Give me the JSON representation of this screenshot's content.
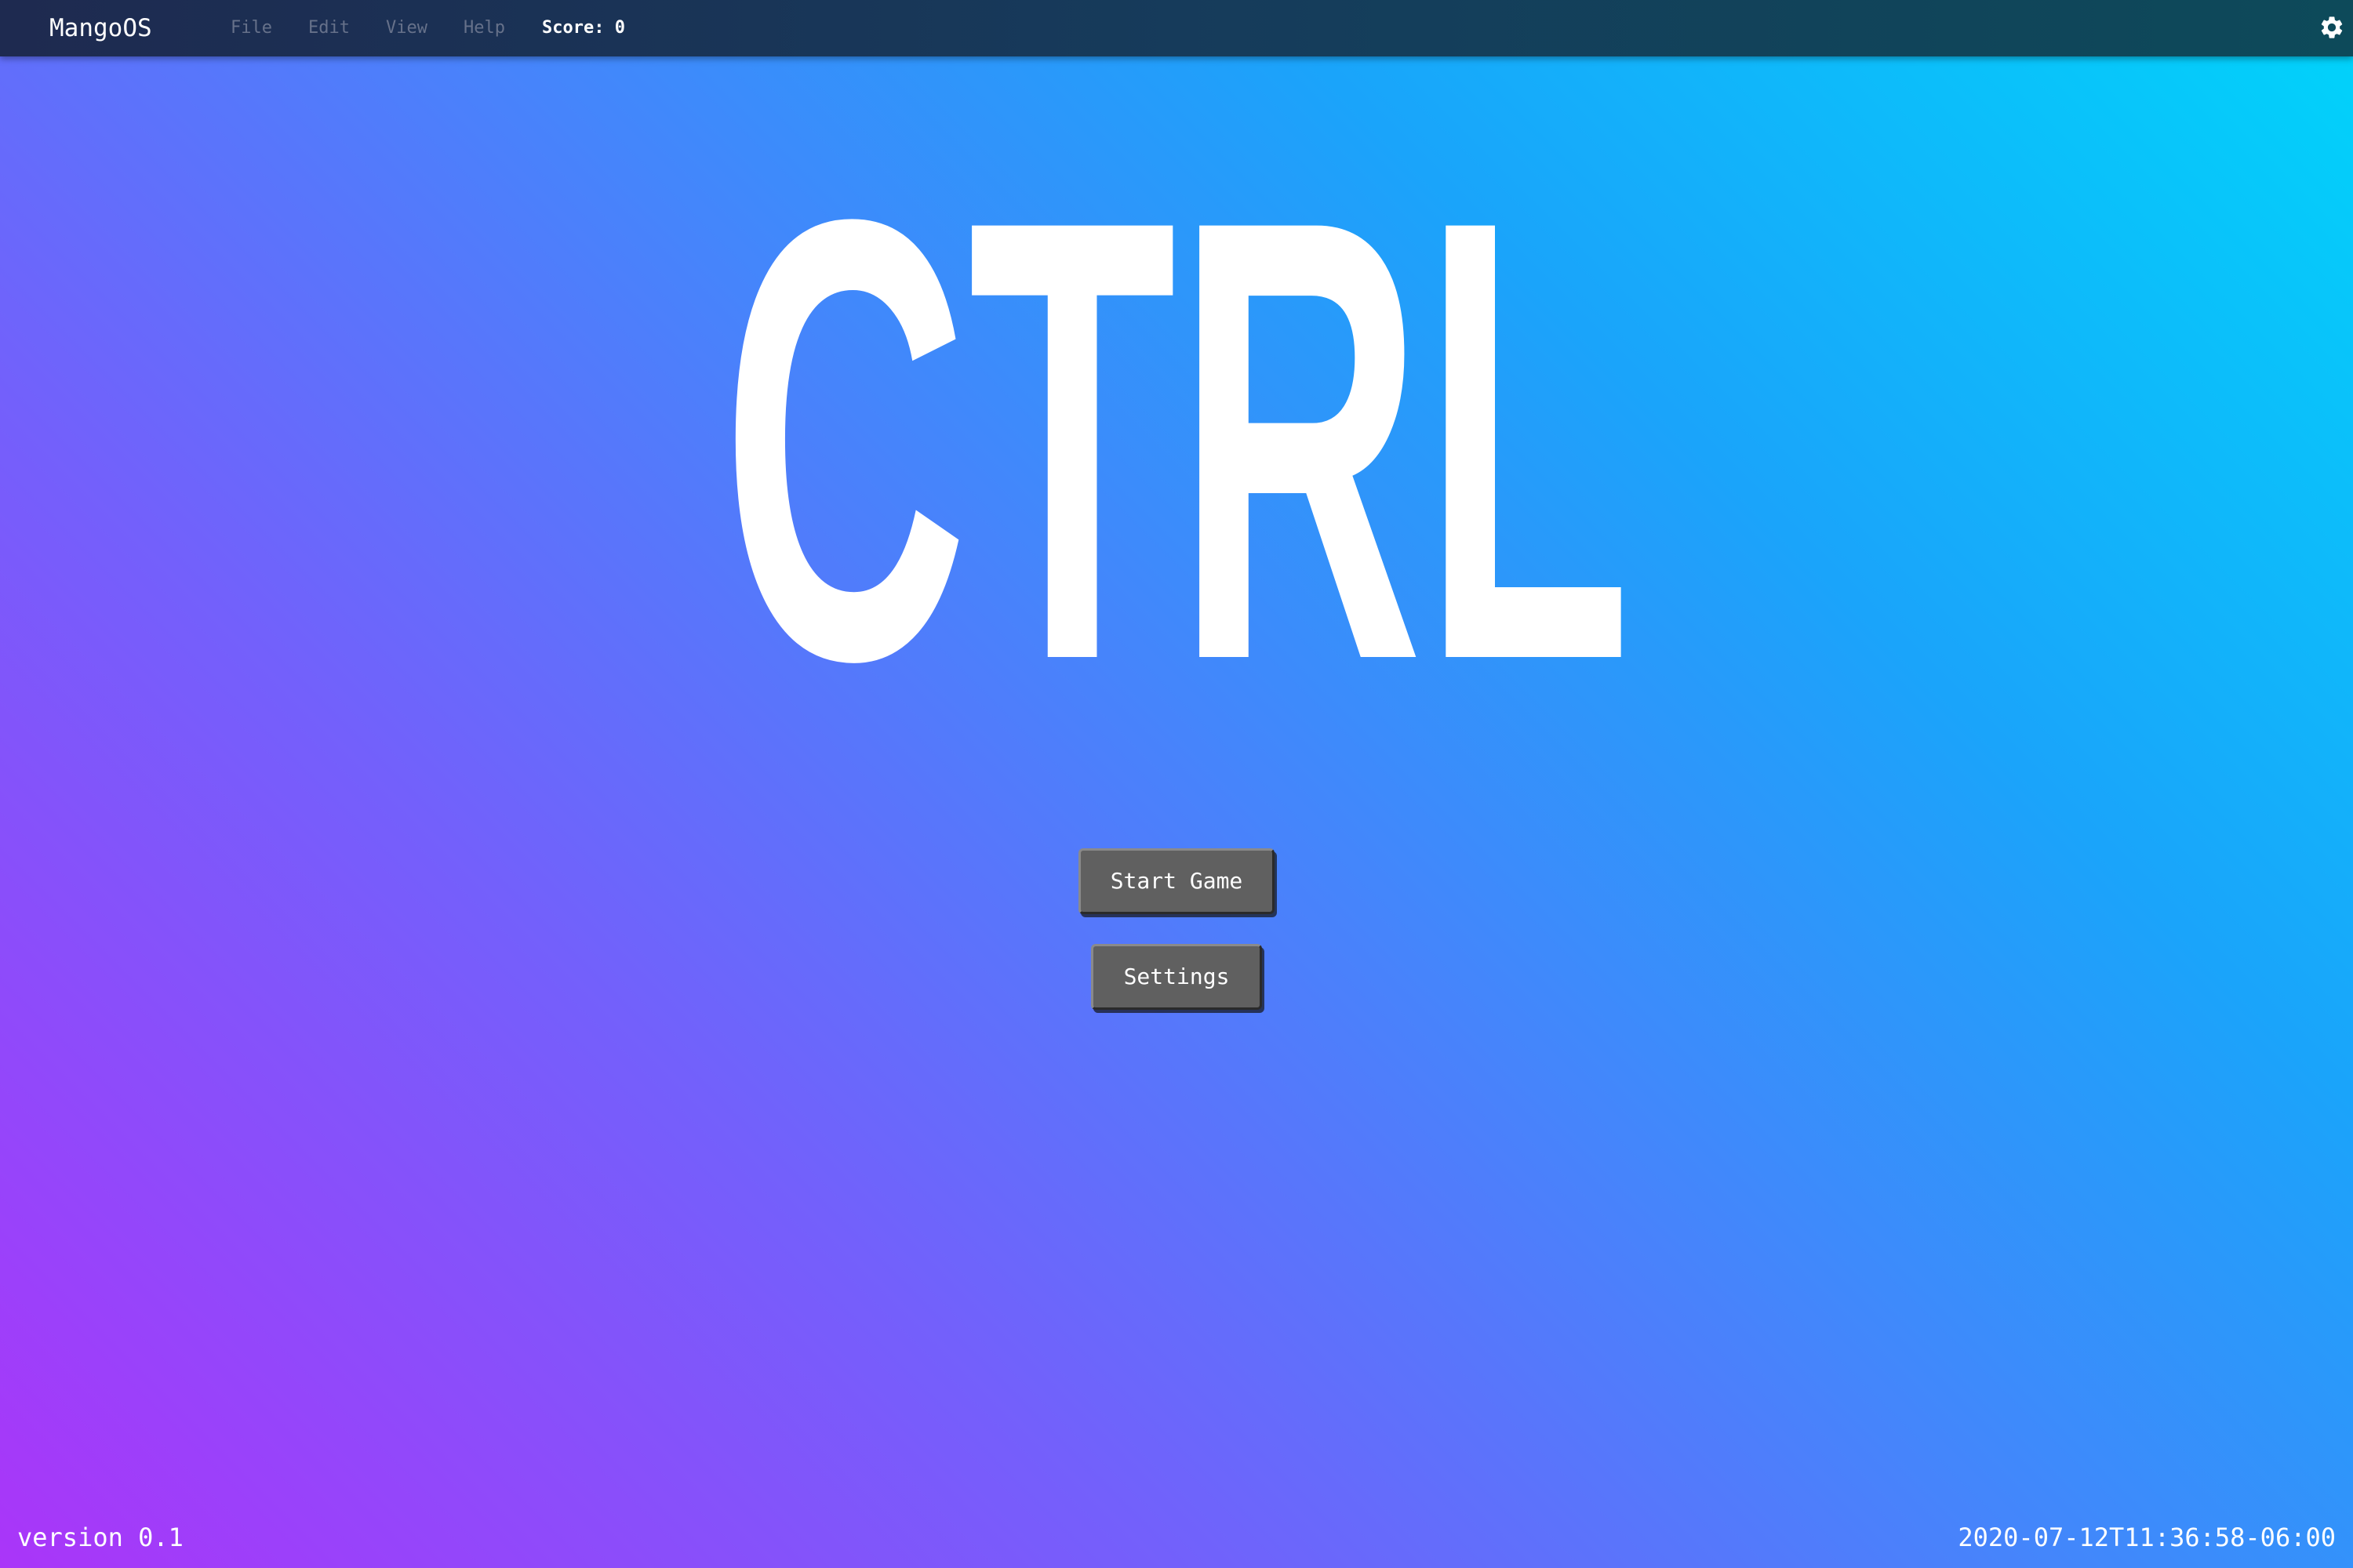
{
  "menubar": {
    "brand": "MangoOS",
    "items": [
      {
        "label": "File"
      },
      {
        "label": "Edit"
      },
      {
        "label": "View"
      },
      {
        "label": "Help"
      }
    ],
    "score_label": "Score: 0",
    "settings_icon": "gear-icon"
  },
  "hero": {
    "logo_text": "CTRL"
  },
  "buttons": {
    "start_label": "Start Game",
    "settings_label": "Settings"
  },
  "footer": {
    "version": "version 0.1",
    "timestamp": "2020-07-12T11:36:58-06:00"
  },
  "colors": {
    "gradient_top_right": "#00d4fa",
    "gradient_bottom_left": "#aa35f9",
    "menubar": "#1e2a50",
    "button": "#606060"
  }
}
